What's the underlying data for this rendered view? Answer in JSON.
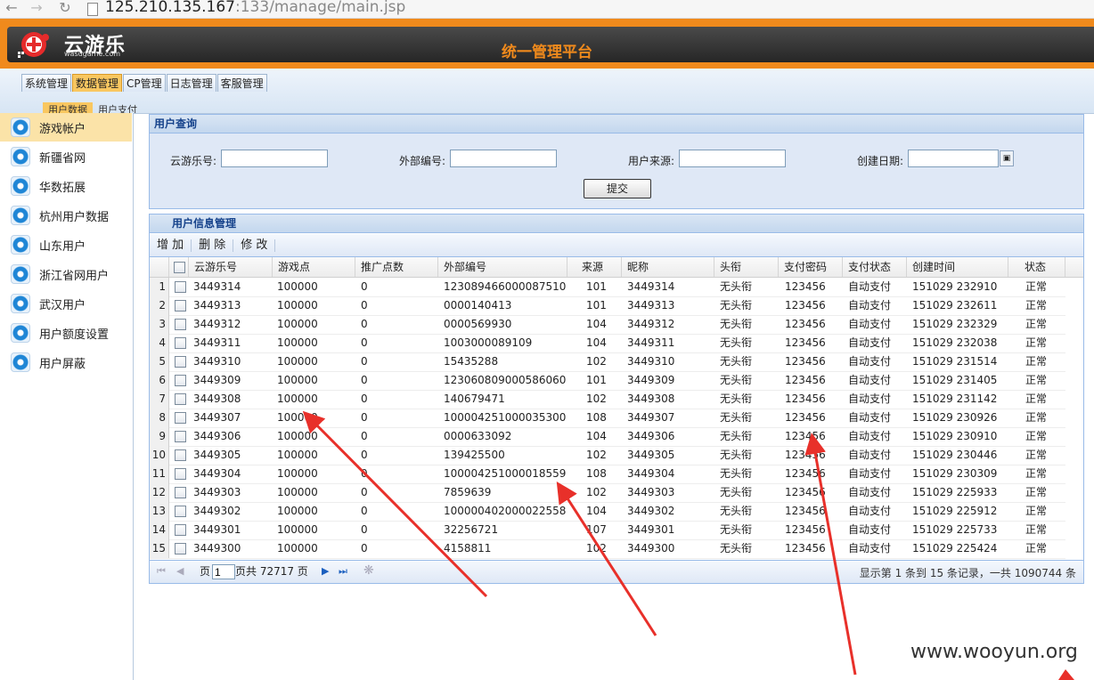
{
  "browser": {
    "url_host": "125.210.135.167",
    "url_rest": ":133/manage/main.jsp"
  },
  "app": {
    "logo_text": "云游乐",
    "logo_sub": "wasugame.com",
    "title": "统一管理平台"
  },
  "menu": {
    "items": [
      {
        "label": "系统管理",
        "active": false
      },
      {
        "label": "数据管理",
        "active": true
      },
      {
        "label": "CP管理",
        "active": false
      },
      {
        "label": "日志管理",
        "active": false
      },
      {
        "label": "客服管理",
        "active": false
      }
    ]
  },
  "submenu": {
    "items": [
      {
        "label": "用户数据",
        "active": true
      },
      {
        "label": "用户支付",
        "active": false
      }
    ]
  },
  "sidebar": {
    "items": [
      {
        "label": "游戏帐户",
        "active": true
      },
      {
        "label": "新疆省网"
      },
      {
        "label": "华数拓展"
      },
      {
        "label": "杭州用户数据"
      },
      {
        "label": "山东用户"
      },
      {
        "label": "浙江省网用户"
      },
      {
        "label": "武汉用户"
      },
      {
        "label": "用户额度设置"
      },
      {
        "label": "用户屏蔽"
      }
    ]
  },
  "query": {
    "title": "用户查询",
    "fields": {
      "yunyoule": "云游乐号:",
      "external": "外部编号:",
      "source": "用户来源:",
      "created": "创建日期:"
    },
    "submit": "提交"
  },
  "grid": {
    "title": "用户信息管理",
    "toolbar": {
      "add": "增 加",
      "delete": "删 除",
      "edit": "修 改"
    },
    "columns": [
      "云游乐号",
      "游戏点",
      "推广点数",
      "外部编号",
      "来源",
      "昵称",
      "头衔",
      "支付密码",
      "支付状态",
      "创建时间",
      "状态"
    ],
    "rows": [
      [
        "3449314",
        "100000",
        "0",
        "123089466000087510",
        "101",
        "3449314",
        "无头衔",
        "123456",
        "自动支付",
        "151029 232910",
        "正常"
      ],
      [
        "3449313",
        "100000",
        "0",
        "0000140413",
        "101",
        "3449313",
        "无头衔",
        "123456",
        "自动支付",
        "151029 232611",
        "正常"
      ],
      [
        "3449312",
        "100000",
        "0",
        "0000569930",
        "104",
        "3449312",
        "无头衔",
        "123456",
        "自动支付",
        "151029 232329",
        "正常"
      ],
      [
        "3449311",
        "100000",
        "0",
        "1003000089109",
        "104",
        "3449311",
        "无头衔",
        "123456",
        "自动支付",
        "151029 232038",
        "正常"
      ],
      [
        "3449310",
        "100000",
        "0",
        "15435288",
        "102",
        "3449310",
        "无头衔",
        "123456",
        "自动支付",
        "151029 231514",
        "正常"
      ],
      [
        "3449309",
        "100000",
        "0",
        "123060809000586060",
        "101",
        "3449309",
        "无头衔",
        "123456",
        "自动支付",
        "151029 231405",
        "正常"
      ],
      [
        "3449308",
        "100000",
        "0",
        "140679471",
        "102",
        "3449308",
        "无头衔",
        "123456",
        "自动支付",
        "151029 231142",
        "正常"
      ],
      [
        "3449307",
        "100000",
        "0",
        "100004251000035300",
        "108",
        "3449307",
        "无头衔",
        "123456",
        "自动支付",
        "151029 230926",
        "正常"
      ],
      [
        "3449306",
        "100000",
        "0",
        "0000633092",
        "104",
        "3449306",
        "无头衔",
        "123456",
        "自动支付",
        "151029 230910",
        "正常"
      ],
      [
        "3449305",
        "100000",
        "0",
        "139425500",
        "102",
        "3449305",
        "无头衔",
        "123456",
        "自动支付",
        "151029 230446",
        "正常"
      ],
      [
        "3449304",
        "100000",
        "0",
        "100004251000018559",
        "108",
        "3449304",
        "无头衔",
        "123456",
        "自动支付",
        "151029 230309",
        "正常"
      ],
      [
        "3449303",
        "100000",
        "0",
        "7859639",
        "102",
        "3449303",
        "无头衔",
        "123456",
        "自动支付",
        "151029 225933",
        "正常"
      ],
      [
        "3449302",
        "100000",
        "0",
        "100000402000022558",
        "104",
        "3449302",
        "无头衔",
        "123456",
        "自动支付",
        "151029 225912",
        "正常"
      ],
      [
        "3449301",
        "100000",
        "0",
        "32256721",
        "107",
        "3449301",
        "无头衔",
        "123456",
        "自动支付",
        "151029 225733",
        "正常"
      ],
      [
        "3449300",
        "100000",
        "0",
        "4158811",
        "102",
        "3449300",
        "无头衔",
        "123456",
        "自动支付",
        "151029 225424",
        "正常"
      ]
    ],
    "pager": {
      "page_label": "页",
      "page": "1",
      "total": "页共 72717 页",
      "info": "显示第 1 条到 15 条记录，一共 1090744 条"
    }
  },
  "watermark": "www.wooyun.org",
  "colors": {
    "header_orange": "#f08a1c",
    "active_tab": "#f9c760",
    "panel_title": "#15428b",
    "arrow": "#e8302a"
  }
}
